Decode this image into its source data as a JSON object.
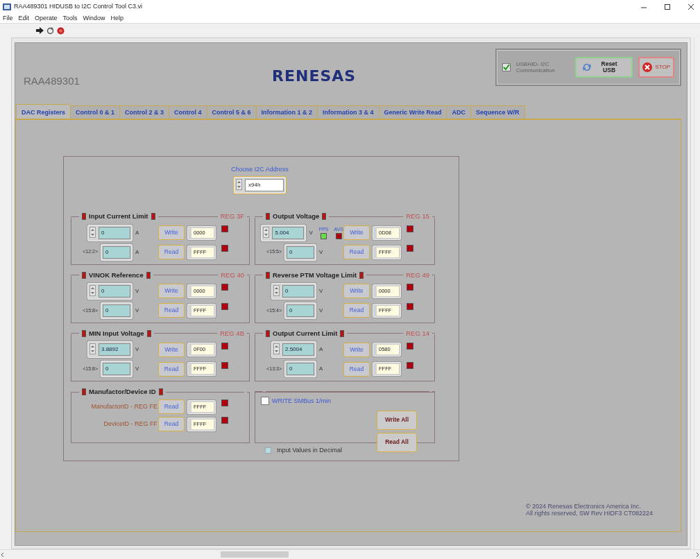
{
  "window": {
    "title": "RAA489301 HIDUSB to I2C Control Tool C3.vi"
  },
  "menu": [
    "File",
    "Edit",
    "Operate",
    "Tools",
    "Window",
    "Help"
  ],
  "header": {
    "part": "RAA489301",
    "logo": "RENESAS",
    "comm": {
      "label": "USBHID- I2C Communication",
      "checked": true,
      "disabled": true
    },
    "reset_button": "Reset USB",
    "stop_button": "STOP"
  },
  "tabs": [
    {
      "label": "DAC Registers",
      "selected": true
    },
    {
      "label": "Control 0 & 1",
      "selected": false
    },
    {
      "label": "Control 2 & 3",
      "selected": false
    },
    {
      "label": "Control 4",
      "selected": false
    },
    {
      "label": "Control 5 & 6",
      "selected": false
    },
    {
      "label": "Information 1 & 2",
      "selected": false
    },
    {
      "label": "Information 3 & 4",
      "selected": false
    },
    {
      "label": "Generic Write Read",
      "selected": false
    },
    {
      "label": "ADC",
      "selected": false
    },
    {
      "label": "Sequence W/R",
      "selected": false
    }
  ],
  "address": {
    "label": "Choose I2C Address",
    "value": "x94h"
  },
  "groups": [
    {
      "kind": "register",
      "title": "Input Current Limit",
      "reg": "REG 3F",
      "write": {
        "value": "0",
        "unit": "A",
        "button": "Write",
        "hex": "0000"
      },
      "read": {
        "bits": "<12:2>",
        "value": "0",
        "unit": "A",
        "button": "Read",
        "hex": "FFFF"
      }
    },
    {
      "kind": "register",
      "title": "Output Voltage",
      "reg": "REG 15",
      "write": {
        "value": "5.004",
        "unit": "V",
        "button": "Write",
        "hex": "0D08"
      },
      "read": {
        "bits": "<15:5>",
        "value": "0",
        "unit": "V",
        "button": "Read",
        "hex": "FFFF"
      },
      "indicators": [
        {
          "label": "PPS",
          "on": true
        },
        {
          "label": "AVS",
          "on": false
        }
      ]
    },
    {
      "kind": "register",
      "title": "VINOK Reference",
      "reg": "REG 40",
      "write": {
        "value": "0",
        "unit": "V",
        "button": "Write",
        "hex": "0000"
      },
      "read": {
        "bits": "<15:8>",
        "value": "0",
        "unit": "V",
        "button": "Read",
        "hex": "FFFF"
      }
    },
    {
      "kind": "register",
      "title": "Reverse PTM Voltage Limit",
      "reg": "REG 49",
      "write": {
        "value": "0",
        "unit": "V",
        "button": "Write",
        "hex": "0000"
      },
      "read": {
        "bits": "<15:4>",
        "value": "0",
        "unit": "V",
        "button": "Read",
        "hex": "FFFF"
      }
    },
    {
      "kind": "register",
      "title": "MIN Input Voltage",
      "reg": "REG 4B",
      "write": {
        "value": "3.8892",
        "unit": "V",
        "button": "Write",
        "hex": "0F00"
      },
      "read": {
        "bits": "<15:8>",
        "value": "0",
        "unit": "V",
        "button": "Read",
        "hex": "FFFF"
      }
    },
    {
      "kind": "register",
      "title": "Output Current Limit",
      "reg": "REG 14",
      "write": {
        "value": "2.5004",
        "unit": "A",
        "button": "Write",
        "hex": "0580"
      },
      "read": {
        "bits": "<13:3>",
        "value": "0",
        "unit": "A",
        "button": "Read",
        "hex": "FFFF"
      }
    },
    {
      "kind": "id",
      "title": "Manufactor/Device ID",
      "rows": [
        {
          "label": "ManufactorID - REG FE",
          "button": "Read",
          "hex": "FFFF"
        },
        {
          "label": "DeviceID - REG FF",
          "button": "Read",
          "hex": "FFFF"
        }
      ]
    },
    {
      "kind": "actions",
      "checkbox": {
        "label": "WRITE SMBus 1/min",
        "checked": false
      },
      "buttons": [
        "Write All",
        "Read All"
      ]
    }
  ],
  "decimal": {
    "label": "Input Values in Decimal",
    "checked": false
  },
  "copyright": [
    "© 2024 Renesas Electronics America Inc.",
    "All rights reserved, SW Rev HIDF3 CT082224"
  ]
}
